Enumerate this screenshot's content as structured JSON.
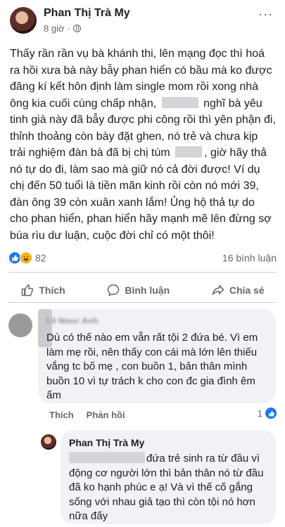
{
  "post": {
    "author": "Phan Thị Trà My",
    "time": "8 giờ",
    "separator": "·",
    "more": "···",
    "body_parts": [
      "Thấy rần rần vụ bà khánh thi, lên mạng đọc thì hoá ra hồi xưa bà này bẫy phan hiển có bầu mà ko được đăng kí kết hôn định làm single mom rồi xong nhà ông kia cuối cùng chấp nhận,",
      "nghĩ bà yêu tinh già này đã bẫy được phi công rồi thì yên phận đi, thỉnh thoảng còn bày đặt ghen, nó trẻ và chưa kịp trải nghiệm đàn bà đã bị chị túm",
      ", giờ hãy thả nó tự do đi, làm sao mà giữ nó cả đời được! Ví dụ chị đến 50 tuổi là tiền mãn kinh rồi còn nó mới 39, đàn ông 39 còn xuân xanh lắm! Ủng hộ thả tự do cho phan hiển, phan hiển hãy mạnh mẽ lên đừng sợ búa rìu dư luận, cuộc đời chỉ có một thôi!"
    ],
    "reaction_count": "82",
    "comment_count": "16 bình luận"
  },
  "actions": {
    "like": "Thích",
    "comment": "Bình luận",
    "share": "Chia sẻ"
  },
  "comments": [
    {
      "author": "Lê Ngọc Anh",
      "text": "Dù có thế nào em vẫn rất tội 2 đứa bé. Vì em làm mẹ rồi, nên thấy con cái mà lớn lên thiếu vắng tc bố mẹ , con buồn 1, bản thân mình buồn 10 vì tự trách k cho con đc gia đình êm ấm",
      "like_label": "Thích",
      "reply_label": "Phản hồi",
      "likes": "1"
    },
    {
      "author": "Phan Thị Trà My",
      "text": "đứa trẻ sinh ra từ đầu vì động cơ người lớn thì bản thân nó từ đầu đã ko hạnh phúc e ạ! Và vì thế cố gắng sống với nhau giả tạo thì còn tội nó hơn nữa đấy"
    }
  ],
  "colors": {
    "like_blue": "#1877f2",
    "haha_yellow": "#f7b125",
    "bubble_bg": "#f0f2f5",
    "muted_text": "#65676b"
  }
}
